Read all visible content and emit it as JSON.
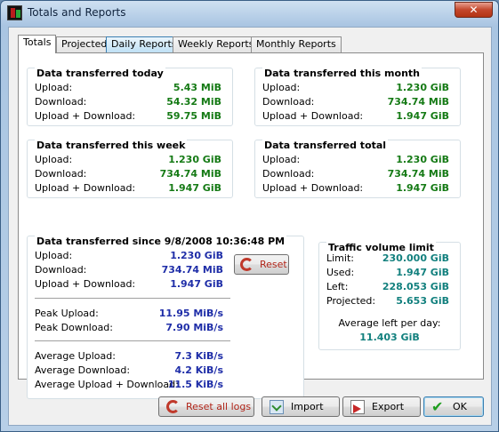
{
  "window": {
    "title": "Totals and Reports",
    "close_glyph": "✕"
  },
  "tabs": [
    {
      "label": "Totals"
    },
    {
      "label": "Projected"
    },
    {
      "label": "Daily Reports"
    },
    {
      "label": "Weekly Reports"
    },
    {
      "label": "Monthly Reports"
    }
  ],
  "today": {
    "title": "Data transferred today",
    "rows": [
      {
        "label": "Upload:",
        "value": "5.43 MiB"
      },
      {
        "label": "Download:",
        "value": "54.32 MiB"
      },
      {
        "label": "Upload + Download:",
        "value": "59.75 MiB"
      }
    ]
  },
  "month": {
    "title": "Data transferred this month",
    "rows": [
      {
        "label": "Upload:",
        "value": "1.230 GiB"
      },
      {
        "label": "Download:",
        "value": "734.74 MiB"
      },
      {
        "label": "Upload + Download:",
        "value": "1.947 GiB"
      }
    ]
  },
  "week": {
    "title": "Data transferred this week",
    "rows": [
      {
        "label": "Upload:",
        "value": "1.230 GiB"
      },
      {
        "label": "Download:",
        "value": "734.74 MiB"
      },
      {
        "label": "Upload + Download:",
        "value": "1.947 GiB"
      }
    ]
  },
  "total": {
    "title": "Data transferred total",
    "rows": [
      {
        "label": "Upload:",
        "value": "1.230 GiB"
      },
      {
        "label": "Download:",
        "value": "734.74 MiB"
      },
      {
        "label": "Upload + Download:",
        "value": "1.947 GiB"
      }
    ]
  },
  "since": {
    "title": "Data transferred since 9/8/2008 10:36:48 PM",
    "rows": [
      {
        "label": "Upload:",
        "value": "1.230 GiB"
      },
      {
        "label": "Download:",
        "value": "734.74 MiB"
      },
      {
        "label": "Upload + Download:",
        "value": "1.947 GiB"
      }
    ],
    "peak": [
      {
        "label": "Peak Upload:",
        "value": "11.95 MiB/s"
      },
      {
        "label": "Peak Download:",
        "value": "7.90 MiB/s"
      }
    ],
    "average": [
      {
        "label": "Average Upload:",
        "value": "7.3 KiB/s"
      },
      {
        "label": "Average Download:",
        "value": "4.2 KiB/s"
      },
      {
        "label": "Average Upload + Download:",
        "value": "11.5 KiB/s"
      }
    ],
    "reset_label": "Reset"
  },
  "limit": {
    "title": "Traffic volume limit",
    "rows": [
      {
        "label": "Limit:",
        "value": "230.000 GiB"
      },
      {
        "label": "Used:",
        "value": "1.947 GiB"
      },
      {
        "label": "Left:",
        "value": "228.053 GiB"
      },
      {
        "label": "Projected:",
        "value": "5.653 GiB"
      }
    ],
    "avg_left_label": "Average left per day:",
    "avg_left_value": "11.403 GiB"
  },
  "footer": {
    "reset_all_label": "Reset all logs",
    "import_label": "Import",
    "export_label": "Export",
    "ok_label": "OK"
  },
  "colors": {
    "green_value": "#157a15",
    "blue_value": "#1f2ea8",
    "teal_value": "#12807e",
    "reset_red": "#c0392b"
  },
  "icons": [
    "app-icon",
    "close-icon",
    "reset-icon",
    "import-icon",
    "export-icon",
    "ok-check-icon"
  ]
}
